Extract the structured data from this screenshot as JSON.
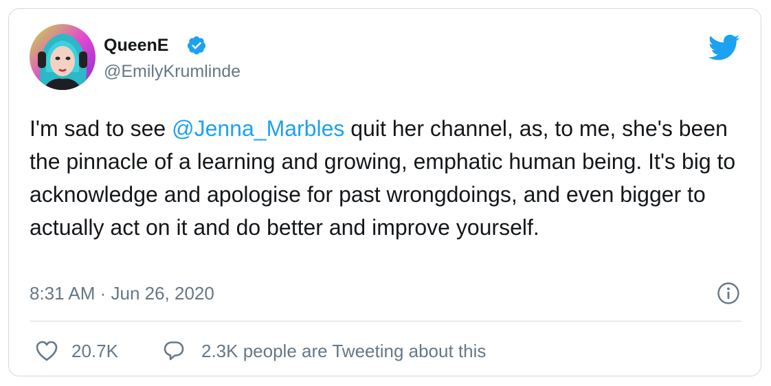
{
  "tweet": {
    "author": {
      "display_name": "QueenE",
      "handle": "@EmilyKrumlinde",
      "verified": true,
      "avatar_icon": "avatar-image"
    },
    "text_before_mention": "I'm sad to see ",
    "mention": "@Jenna_Marbles",
    "text_after_mention": " quit her channel, as, to me, she's been the pinnacle of a learning and growing, emphatic human being. It's big to acknowledge and apologise for past wrongdoings, and even bigger to actually act on it and do better and improve yourself.",
    "timestamp": "8:31 AM · Jun 26, 2020",
    "likes": "20.7K",
    "conversation": "2.3K people are Tweeting about this"
  },
  "icons": {
    "brand": "twitter-bird-icon",
    "verified": "verified-badge-icon",
    "info": "info-icon",
    "like": "heart-icon",
    "reply": "speech-bubble-icon"
  },
  "colors": {
    "brand_blue": "#1da1f2",
    "text_primary": "#14171a",
    "text_secondary": "#657786",
    "border": "#cfd9de"
  }
}
